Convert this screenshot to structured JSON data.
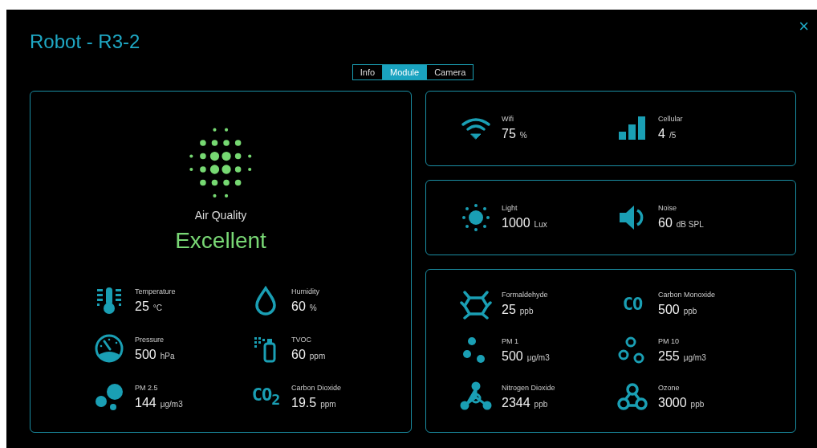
{
  "window": {
    "title": "Robot - R3-2",
    "close": "×"
  },
  "tabs": [
    {
      "label": "Info",
      "selected": false
    },
    {
      "label": "Module",
      "selected": true
    },
    {
      "label": "Camera",
      "selected": false
    }
  ],
  "air_quality": {
    "label": "Air Quality",
    "status": "Excellent"
  },
  "air_metrics": [
    {
      "kind": "thermometer",
      "label": "Temperature",
      "value": "25",
      "unit": "°C"
    },
    {
      "kind": "drop",
      "label": "Humidity",
      "value": "60",
      "unit": "%"
    },
    {
      "kind": "gauge",
      "label": "Pressure",
      "value": "500",
      "unit": "hPa"
    },
    {
      "kind": "spray",
      "label": "TVOC",
      "value": "60",
      "unit": "ppm"
    },
    {
      "kind": "particles",
      "label": "PM 2.5",
      "value": "144",
      "unit": "μg/m3"
    },
    {
      "kind": "formula",
      "symbol": "CO$_{2}$",
      "label": "Carbon Dioxide",
      "value": "19.5",
      "unit": "ppm"
    }
  ],
  "connectivity": [
    {
      "kind": "wifi",
      "label": "Wifi",
      "value": "75",
      "unit": "%"
    },
    {
      "kind": "bars",
      "label": "Cellular",
      "value": "4",
      "unit": "/5"
    }
  ],
  "environment": [
    {
      "kind": "sun",
      "label": "Light",
      "value": "1000",
      "unit": "Lux"
    },
    {
      "kind": "speaker",
      "label": "Noise",
      "value": "60",
      "unit": "dB SPL"
    }
  ],
  "gases": [
    {
      "kind": "molecule",
      "label": "Formaldehyde",
      "value": "25",
      "unit": "ppb"
    },
    {
      "kind": "formula",
      "symbol": "CO",
      "label": "Carbon Monoxide",
      "value": "500",
      "unit": "ppb"
    },
    {
      "kind": "dots",
      "label": "PM 1",
      "value": "500",
      "unit": "μg/m3"
    },
    {
      "kind": "rings",
      "label": "PM 10",
      "value": "255",
      "unit": "μg/m3"
    },
    {
      "kind": "nodes",
      "label": "Nitrogen Dioxide",
      "value": "2344",
      "unit": "ppb"
    },
    {
      "kind": "ozone",
      "label": "Ozone",
      "value": "3000",
      "unit": "ppb"
    }
  ]
}
